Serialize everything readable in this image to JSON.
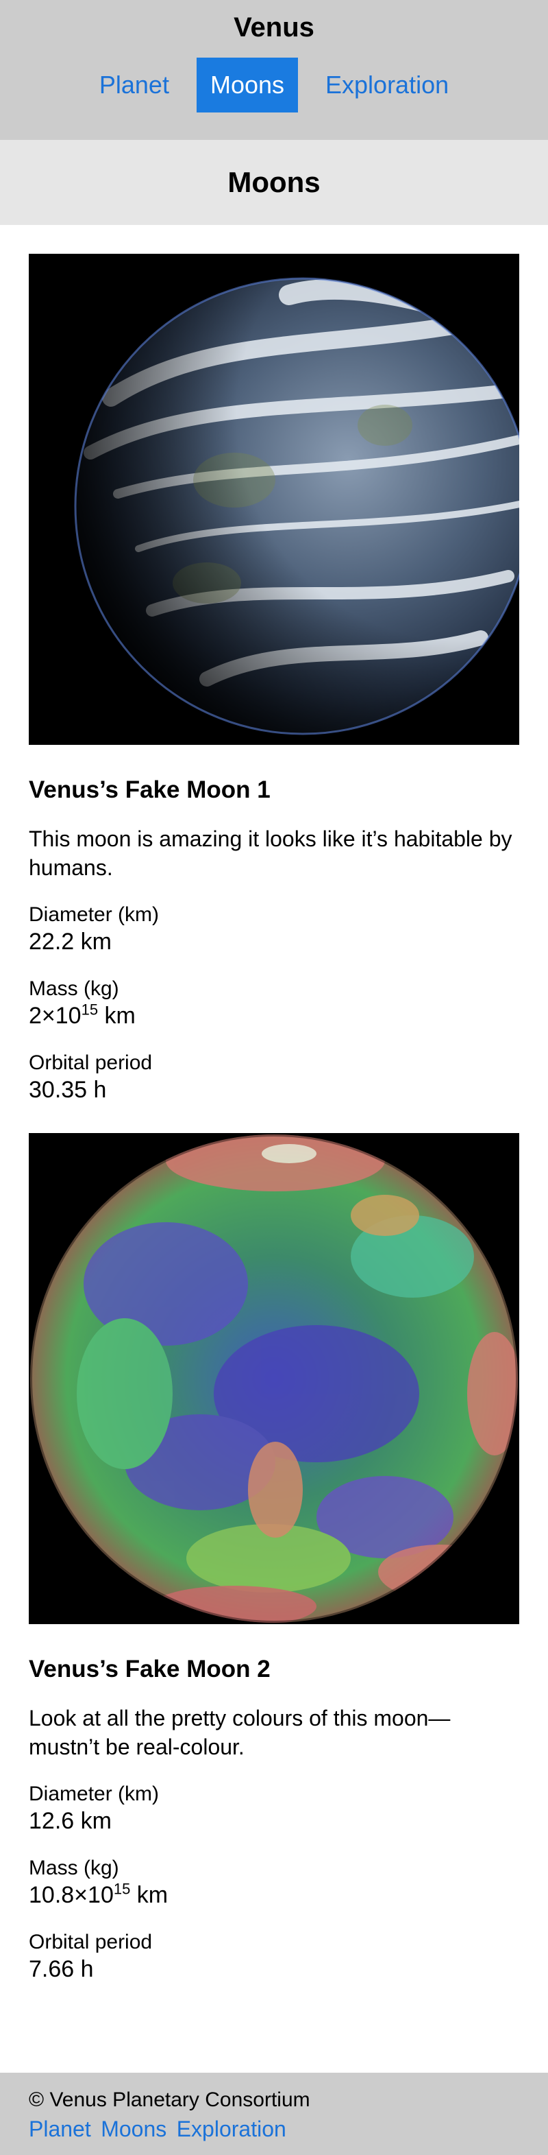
{
  "header": {
    "title": "Venus",
    "nav": [
      {
        "label": "Planet",
        "active": false
      },
      {
        "label": "Moons",
        "active": true
      },
      {
        "label": "Exploration",
        "active": false
      }
    ]
  },
  "page": {
    "title": "Moons"
  },
  "moons": [
    {
      "name": "Venus’s Fake Moon 1",
      "description": "This moon is amazing it looks like it’s habitable by humans.",
      "diameter_label": "Diameter (km)",
      "diameter_value": "22.2 km",
      "mass_label": "Mass (kg)",
      "mass_base": "2×10",
      "mass_exp": "15",
      "mass_unit": " km",
      "period_label": "Orbital period",
      "period_value": "30.35 h"
    },
    {
      "name": "Venus’s Fake Moon 2",
      "description": "Look at all the pretty colours of this moon—mustn’t be real-colour.",
      "diameter_label": "Diameter (km)",
      "diameter_value": "12.6 km",
      "mass_label": "Mass (kg)",
      "mass_base": "10.8×10",
      "mass_exp": "15",
      "mass_unit": " km",
      "period_label": "Orbital period",
      "period_value": "7.66 h"
    }
  ],
  "footer": {
    "copyright": "© Venus Planetary Consortium",
    "links": [
      "Planet",
      "Moons",
      "Exploration"
    ]
  }
}
